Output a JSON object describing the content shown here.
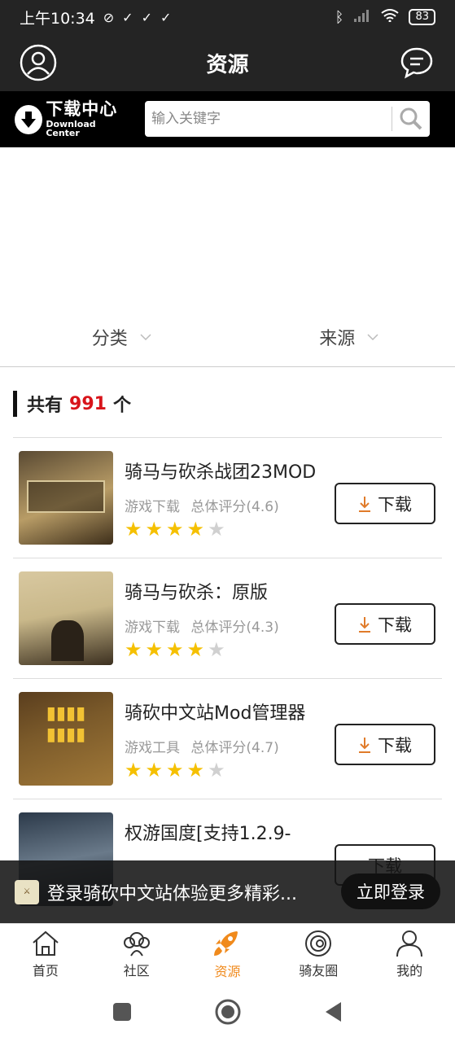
{
  "status_bar": {
    "time": "上午10:34",
    "battery": "83"
  },
  "header": {
    "title": "资源"
  },
  "search": {
    "logo_cn": "下载中心",
    "logo_en": "Download Center",
    "placeholder": "输入关键字"
  },
  "filters": {
    "category": "分类",
    "source": "来源"
  },
  "summary": {
    "prefix": "共有",
    "count": "991",
    "suffix": "个"
  },
  "list": {
    "items": [
      {
        "title": "骑马与砍杀战团23MOD",
        "type": "游戏下载",
        "rating": "总体评分(4.6)",
        "stars": 4,
        "button": "下载",
        "thumb_colors": [
          "#5a4a33",
          "#b89c66"
        ]
      },
      {
        "title": "骑马与砍杀：原版",
        "type": "游戏下载",
        "rating": "总体评分(4.3)",
        "stars": 4,
        "button": "下载",
        "thumb_colors": [
          "#c9b88a",
          "#3c3020"
        ]
      },
      {
        "title": "骑砍中文站Mod管理器",
        "type": "游戏工具",
        "rating": "总体评分(4.7)",
        "stars": 4,
        "button": "下载",
        "thumb_colors": [
          "#7b5a2a",
          "#e0b240"
        ]
      },
      {
        "title": "权游国度[支持1.2.9-",
        "type": "",
        "rating": "",
        "stars": 0,
        "button": "下载",
        "thumb_colors": [
          "#2c3a4a",
          "#6a7a8a"
        ]
      }
    ]
  },
  "login_banner": {
    "text": "登录骑砍中文站体验更多精彩...",
    "button": "立即登录"
  },
  "tabs": [
    {
      "label": "首页",
      "icon": "home-icon"
    },
    {
      "label": "社区",
      "icon": "community-icon"
    },
    {
      "label": "资源",
      "icon": "rocket-icon"
    },
    {
      "label": "骑友圈",
      "icon": "circle-icon"
    },
    {
      "label": "我的",
      "icon": "profile-icon"
    }
  ],
  "colors": {
    "accent": "#f08a1c",
    "count": "#d8141a",
    "star": "#f5c000",
    "dark": "#242424"
  }
}
